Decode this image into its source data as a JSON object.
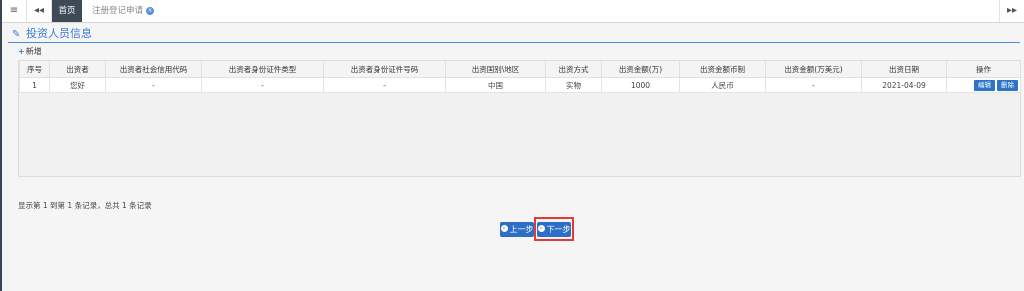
{
  "tabs": {
    "menu_icon": "≡",
    "prev_icon": "◂◂",
    "next_icon": "▸▸",
    "home": "首页",
    "registration": "注册登记申请",
    "close_icon": "×"
  },
  "section": {
    "edit_icon": "✎",
    "title": "投资人员信息"
  },
  "add_button": {
    "plus": "+",
    "label": "新增"
  },
  "table": {
    "headers": [
      "序号",
      "出资者",
      "出资者社会信用代码",
      "出资者身份证件类型",
      "出资者身份证件号码",
      "出资国别\\地区",
      "出资方式",
      "出资金额(万)",
      "出资金额币制",
      "出资金额(万美元)",
      "出资日期",
      "操作"
    ],
    "rows": [
      {
        "cells": [
          "1",
          "您好",
          "-",
          "-",
          "-",
          "中国",
          "实物",
          "1000",
          "人民币",
          "-",
          "2021-04-09"
        ],
        "edit_label": "编辑",
        "delete_label": "删除"
      }
    ]
  },
  "summary": "显示第 1 到第 1 条记录，总共 1 条记录",
  "buttons": {
    "prev_step": "上一步",
    "next_step": "下一步",
    "arrow_icon": "›"
  }
}
